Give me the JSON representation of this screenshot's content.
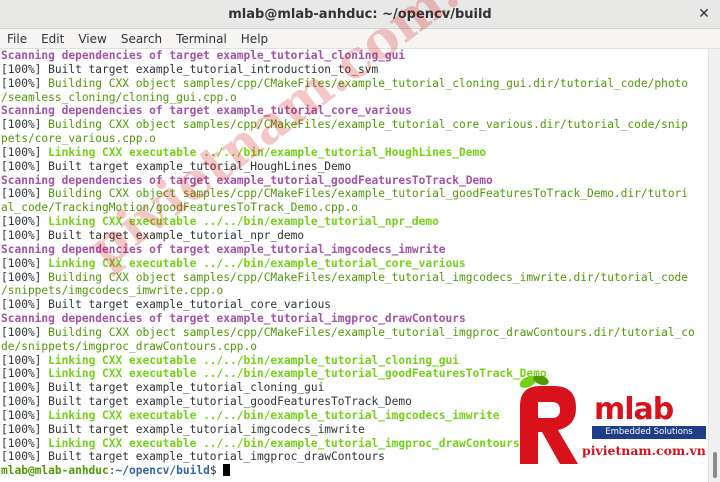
{
  "window": {
    "title": "mlab@mlab-anhduc: ~/opencv/build"
  },
  "menu": [
    "File",
    "Edit",
    "View",
    "Search",
    "Terminal",
    "Help"
  ],
  "terminal": {
    "lines": [
      [
        {
          "t": "Scanning dependencies of target example_tutorial_cloning_gui",
          "c": "scan"
        }
      ],
      [
        {
          "t": "[100%] Built target example_tutorial_introduction_to_svm",
          "c": "plain"
        }
      ],
      [
        {
          "t": "[100%] ",
          "c": "plain"
        },
        {
          "t": "Building CXX object samples/cpp/CMakeFiles/example_tutorial_cloning_gui.dir/tutorial_code/photo",
          "c": "build"
        }
      ],
      [
        {
          "t": "/seamless_cloning/cloning_gui.cpp.o",
          "c": "build"
        }
      ],
      [
        {
          "t": "Scanning dependencies of target example_tutorial_core_various",
          "c": "scan"
        }
      ],
      [
        {
          "t": "[100%] ",
          "c": "plain"
        },
        {
          "t": "Building CXX object samples/cpp/CMakeFiles/example_tutorial_core_various.dir/tutorial_code/snip",
          "c": "build"
        }
      ],
      [
        {
          "t": "pets/core_various.cpp.o",
          "c": "build"
        }
      ],
      [
        {
          "t": "[100%] ",
          "c": "plain"
        },
        {
          "t": "Linking CXX executable ../../bin/example_tutorial_HoughLines_Demo",
          "c": "link"
        }
      ],
      [
        {
          "t": "[100%] Built target example_tutorial_HoughLines_Demo",
          "c": "plain"
        }
      ],
      [
        {
          "t": "Scanning dependencies of target example_tutorial_goodFeaturesToTrack_Demo",
          "c": "scan"
        }
      ],
      [
        {
          "t": "[100%] ",
          "c": "plain"
        },
        {
          "t": "Building CXX object samples/cpp/CMakeFiles/example_tutorial_goodFeaturesToTrack_Demo.dir/tutori",
          "c": "build"
        }
      ],
      [
        {
          "t": "al_code/TrackingMotion/goodFeaturesToTrack_Demo.cpp.o",
          "c": "build"
        }
      ],
      [
        {
          "t": "[100%] ",
          "c": "plain"
        },
        {
          "t": "Linking CXX executable ../../bin/example_tutorial_npr_demo",
          "c": "link"
        }
      ],
      [
        {
          "t": "[100%] Built target example_tutorial_npr_demo",
          "c": "plain"
        }
      ],
      [
        {
          "t": "Scanning dependencies of target example_tutorial_imgcodecs_imwrite",
          "c": "scan"
        }
      ],
      [
        {
          "t": "[100%] ",
          "c": "plain"
        },
        {
          "t": "Linking CXX executable ../../bin/example_tutorial_core_various",
          "c": "link"
        }
      ],
      [
        {
          "t": "[100%] ",
          "c": "plain"
        },
        {
          "t": "Building CXX object samples/cpp/CMakeFiles/example_tutorial_imgcodecs_imwrite.dir/tutorial_code",
          "c": "build"
        }
      ],
      [
        {
          "t": "/snippets/imgcodecs_imwrite.cpp.o",
          "c": "build"
        }
      ],
      [
        {
          "t": "[100%] Built target example_tutorial_core_various",
          "c": "plain"
        }
      ],
      [
        {
          "t": "Scanning dependencies of target example_tutorial_imgproc_drawContours",
          "c": "scan"
        }
      ],
      [
        {
          "t": "[100%] ",
          "c": "plain"
        },
        {
          "t": "Building CXX object samples/cpp/CMakeFiles/example_tutorial_imgproc_drawContours.dir/tutorial_co",
          "c": "build"
        }
      ],
      [
        {
          "t": "de/snippets/imgproc_drawContours.cpp.o",
          "c": "build"
        }
      ],
      [
        {
          "t": "[100%] ",
          "c": "plain"
        },
        {
          "t": "Linking CXX executable ../../bin/example_tutorial_cloning_gui",
          "c": "link"
        }
      ],
      [
        {
          "t": "[100%] ",
          "c": "plain"
        },
        {
          "t": "Linking CXX executable ../../bin/example_tutorial_goodFeaturesToTrack_Demo",
          "c": "link"
        }
      ],
      [
        {
          "t": "[100%] Built target example_tutorial_cloning_gui",
          "c": "plain"
        }
      ],
      [
        {
          "t": "[100%] Built target example_tutorial_goodFeaturesToTrack_Demo",
          "c": "plain"
        }
      ],
      [
        {
          "t": "[100%] ",
          "c": "plain"
        },
        {
          "t": "Linking CXX executable ../../bin/example_tutorial_imgcodecs_imwrite",
          "c": "link"
        }
      ],
      [
        {
          "t": "[100%] Built target example_tutorial_imgcodecs_imwrite",
          "c": "plain"
        }
      ],
      [
        {
          "t": "[100%] ",
          "c": "plain"
        },
        {
          "t": "Linking CXX executable ../../bin/example_tutorial_imgproc_drawContours",
          "c": "link"
        }
      ],
      [
        {
          "t": "[100%] Built target example_tutorial_imgproc_drawContours",
          "c": "plain"
        }
      ]
    ],
    "prompt": {
      "user_host": "mlab@mlab-anhduc",
      "sep": ":",
      "path": "~/opencv/build",
      "symbol": "$ "
    }
  },
  "watermark": "pivietnam.com.vn",
  "logo": {
    "name": "mlab",
    "tagline": "Embedded Solutions",
    "url": "pivietnam.com.vn"
  },
  "colors": {
    "scanning": "#a352a8",
    "building": "#4e9a06",
    "linking": "#73d216",
    "prompt_user": "#4e9a06",
    "prompt_path": "#3465a4",
    "brand_red": "#d8111a",
    "brand_blue": "#1f3e8a"
  }
}
